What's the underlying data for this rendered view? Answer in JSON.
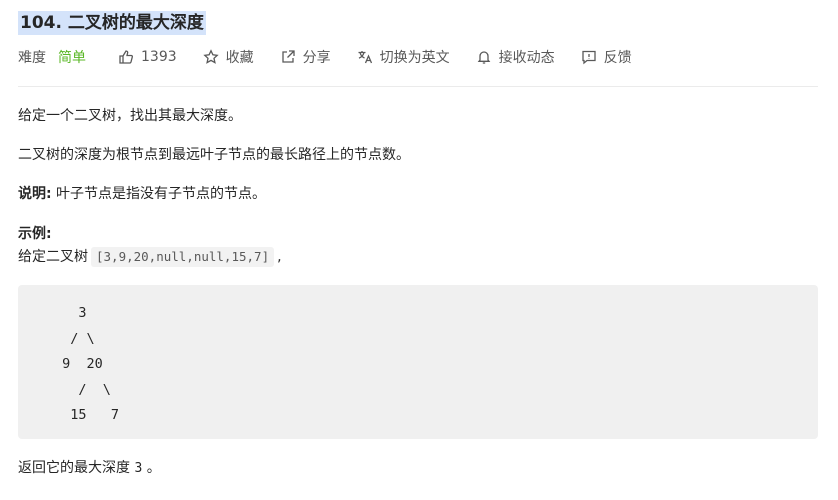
{
  "problem": {
    "title": "104. 二叉树的最大深度",
    "difficulty_label": "难度",
    "difficulty_value": "简单",
    "likes": "1393",
    "favorite_label": "收藏",
    "share_label": "分享",
    "switch_lang_label": "切换为英文",
    "notify_label": "接收动态",
    "feedback_label": "反馈"
  },
  "content": {
    "p1": "给定一个二叉树，找出其最大深度。",
    "p2": "二叉树的深度为根节点到最远叶子节点的最长路径上的节点数。",
    "note_label": "说明:",
    "note_text": " 叶子节点是指没有子节点的节点。",
    "example_label": "示例:",
    "example_prefix": "给定二叉树",
    "example_code": "[3,9,20,null,null,15,7]",
    "example_suffix": ",",
    "tree_block": "   3\n  / \\\n 9  20\n   /  \\\n  15   7",
    "result_prefix": "返回它的最大深度 ",
    "result_value": "3",
    "result_suffix": " 。"
  },
  "colors": {
    "easy": "#5ab726",
    "title_highlight": "#d4e3fa",
    "code_bg": "#f0f0f0"
  },
  "icons": [
    "thumbs-up-icon",
    "star-icon",
    "share-icon",
    "translate-icon",
    "bell-icon",
    "feedback-icon"
  ]
}
